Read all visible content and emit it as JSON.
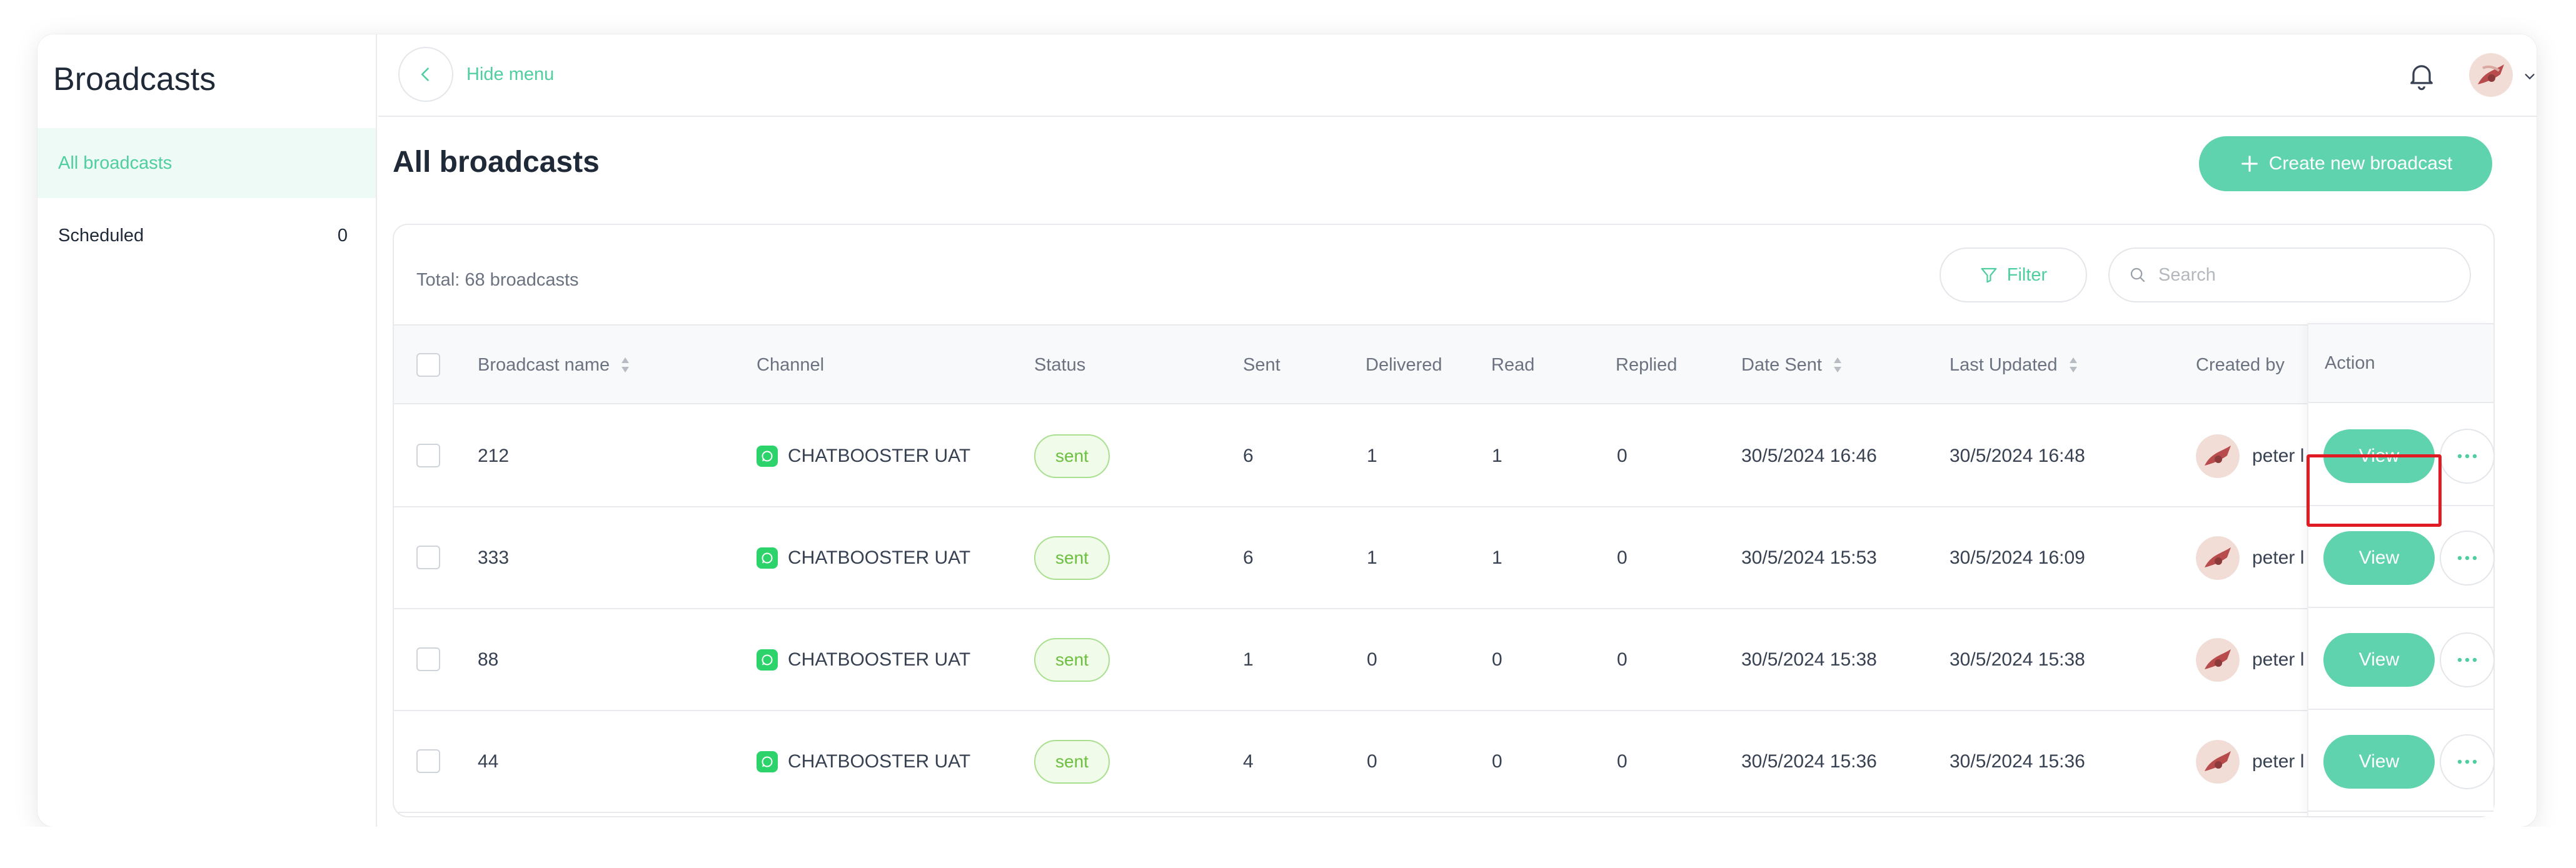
{
  "sidebar": {
    "title": "Broadcasts",
    "items": [
      {
        "label": "All broadcasts",
        "count": ""
      },
      {
        "label": "Scheduled",
        "count": "0"
      }
    ]
  },
  "topbar": {
    "hide_menu_label": "Hide menu",
    "icons": [
      "chevron-left-icon",
      "bell-icon",
      "avatar",
      "chevron-down-icon"
    ]
  },
  "main": {
    "title": "All broadcasts",
    "create_button_label": "Create new broadcast",
    "total_label": "Total: 68 broadcasts",
    "filter_label": "Filter",
    "search_placeholder": "Search"
  },
  "table": {
    "headers": {
      "name": "Broadcast name",
      "channel": "Channel",
      "status": "Status",
      "sent": "Sent",
      "delivered": "Delivered",
      "read": "Read",
      "replied": "Replied",
      "date_sent": "Date Sent",
      "last_updated": "Last Updated",
      "created_by": "Created by",
      "action": "Action"
    },
    "view_label": "View",
    "rows": [
      {
        "name": "212",
        "channel": "CHATBOOSTER UAT",
        "status": "sent",
        "sent": "6",
        "delivered": "1",
        "read": "1",
        "replied": "0",
        "date_sent": "30/5/2024 16:46",
        "last_updated": "30/5/2024 16:48",
        "created_by": "peter l"
      },
      {
        "name": "333",
        "channel": "CHATBOOSTER UAT",
        "status": "sent",
        "sent": "6",
        "delivered": "1",
        "read": "1",
        "replied": "0",
        "date_sent": "30/5/2024 15:53",
        "last_updated": "30/5/2024 16:09",
        "created_by": "peter l"
      },
      {
        "name": "88",
        "channel": "CHATBOOSTER UAT",
        "status": "sent",
        "sent": "1",
        "delivered": "0",
        "read": "0",
        "replied": "0",
        "date_sent": "30/5/2024 15:38",
        "last_updated": "30/5/2024 15:38",
        "created_by": "peter l"
      },
      {
        "name": "44",
        "channel": "CHATBOOSTER UAT",
        "status": "sent",
        "sent": "4",
        "delivered": "0",
        "read": "0",
        "replied": "0",
        "date_sent": "30/5/2024 15:36",
        "last_updated": "30/5/2024 15:36",
        "created_by": "peter l"
      }
    ]
  },
  "colors": {
    "accent": "#5fd3ad",
    "accent_text": "#4fcf9f",
    "status_sent": "#6cbf3f",
    "highlight": "#e01b24"
  }
}
